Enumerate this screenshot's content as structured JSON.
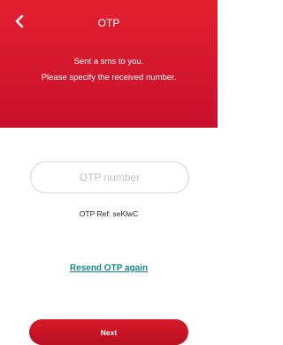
{
  "header": {
    "title": "OTP",
    "message_line1": "Sent a sms to you.",
    "message_line2": "Please specify the received number.",
    "background_color": "#d01a2a"
  },
  "back_icon": "chevron-left-icon",
  "otp_input": {
    "placeholder": "OTP number",
    "value": ""
  },
  "otp_ref": "OTP Ref: seKlwC",
  "resend_link": {
    "label": "Resend OTP again",
    "color": "#138a8a"
  },
  "next_button": {
    "label": "Next",
    "color": "#c8102e"
  }
}
